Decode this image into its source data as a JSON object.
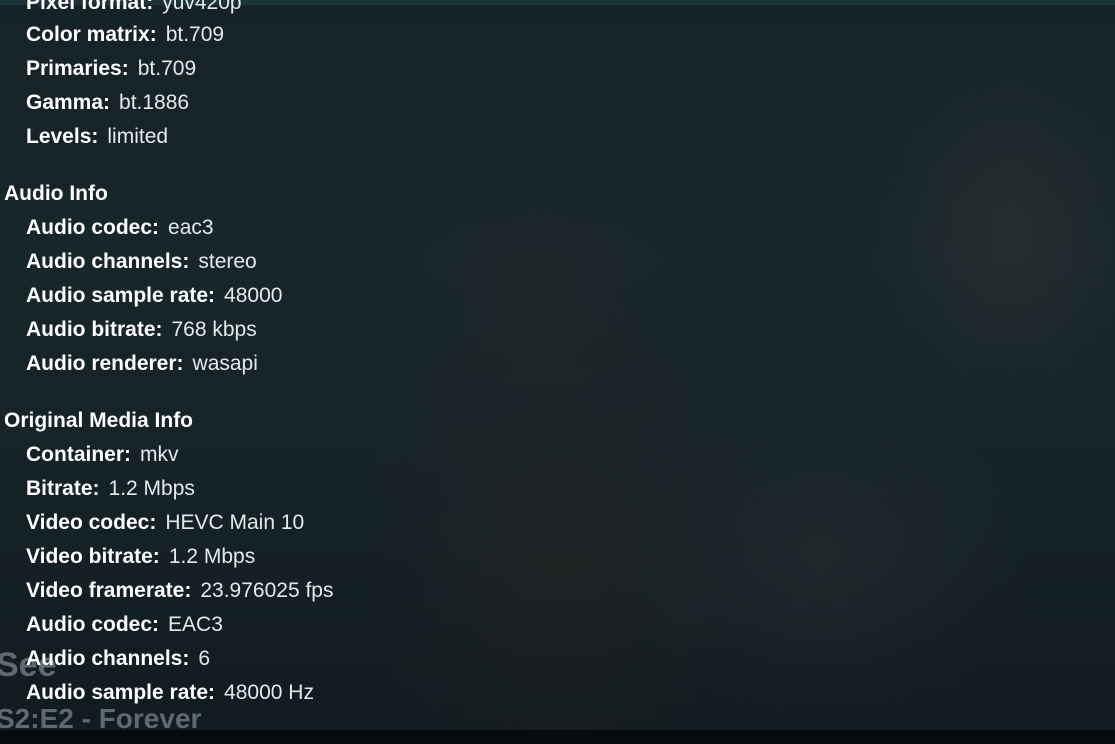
{
  "player": {
    "show_title": "See",
    "episode_title": "S2:E2 - Forever"
  },
  "video_info_partial": {
    "rows": [
      {
        "label": "Pixel format:",
        "value": "yuv420p"
      },
      {
        "label": "Color matrix:",
        "value": "bt.709"
      },
      {
        "label": "Primaries:",
        "value": "bt.709"
      },
      {
        "label": "Gamma:",
        "value": "bt.1886"
      },
      {
        "label": "Levels:",
        "value": "limited"
      }
    ]
  },
  "audio_info": {
    "header": "Audio Info",
    "rows": [
      {
        "label": "Audio codec:",
        "value": "eac3"
      },
      {
        "label": "Audio channels:",
        "value": "stereo"
      },
      {
        "label": "Audio sample rate:",
        "value": "48000"
      },
      {
        "label": "Audio bitrate:",
        "value": "768 kbps"
      },
      {
        "label": "Audio renderer:",
        "value": "wasapi"
      }
    ]
  },
  "original_media_info": {
    "header": "Original Media Info",
    "rows": [
      {
        "label": "Container:",
        "value": "mkv"
      },
      {
        "label": "Bitrate:",
        "value": "1.2 Mbps"
      },
      {
        "label": "Video codec:",
        "value": "HEVC Main 10"
      },
      {
        "label": "Video bitrate:",
        "value": "1.2 Mbps"
      },
      {
        "label": "Video framerate:",
        "value": "23.976025 fps"
      },
      {
        "label": "Audio codec:",
        "value": "EAC3"
      },
      {
        "label": "Audio channels:",
        "value": "6"
      },
      {
        "label": "Audio sample rate:",
        "value": "48000 Hz"
      }
    ]
  }
}
